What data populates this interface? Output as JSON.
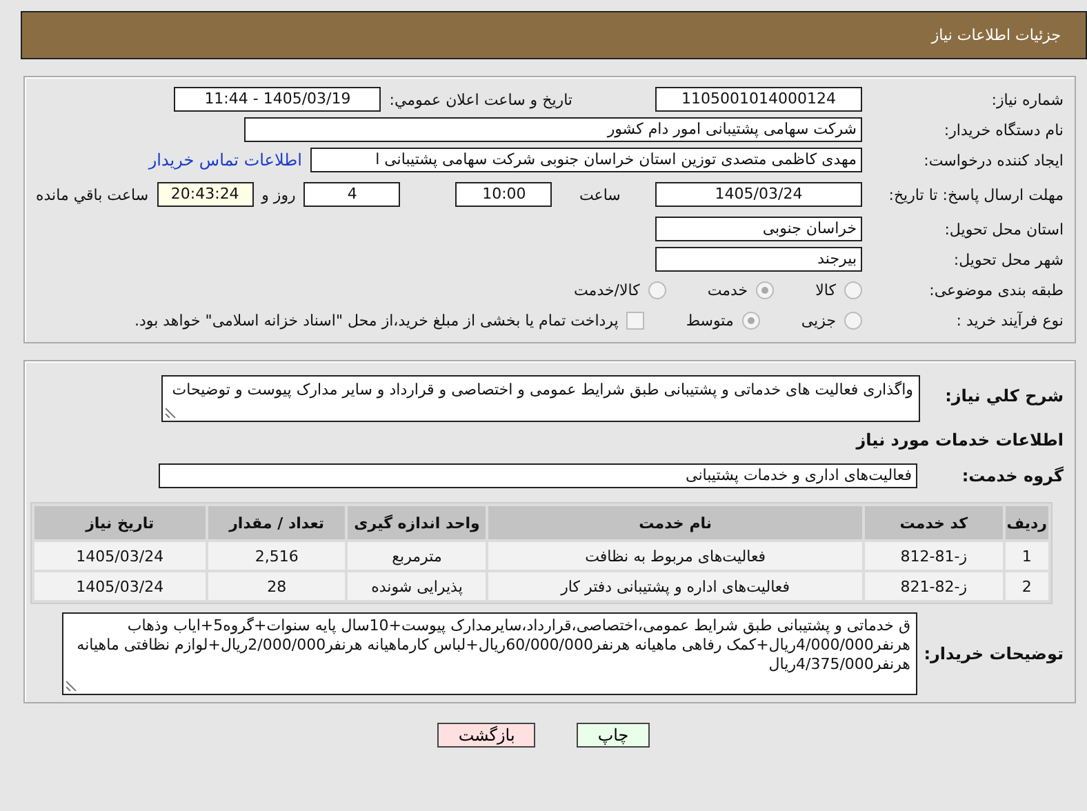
{
  "header": {
    "title": "جزئیات اطلاعات نیاز"
  },
  "details": {
    "need_number": {
      "label": "شماره نیاز:",
      "value": "1105001014000124"
    },
    "announce": {
      "label": "تاریخ و ساعت اعلان عمومي:",
      "value": "1405/03/19 - 11:44"
    },
    "buyer": {
      "label": "نام دستگاه خریدار:",
      "value": "شرکت سهامی پشتیبانی امور دام کشور"
    },
    "creator": {
      "label": "ایجاد کننده درخواست:",
      "value": "مهدی کاظمی متصدی توزین استان خراسان جنوبی شرکت سهامی پشتیبانی ا",
      "link": "اطلاعات تماس خریدار"
    },
    "deadline": {
      "label": "مهلت ارسال پاسخ: تا تاریخ:",
      "date": "1405/03/24",
      "time_label": "ساعت",
      "time": "10:00",
      "days": "4",
      "days_label": "روز و",
      "remaining": "20:43:24",
      "remaining_label": "ساعت باقي مانده"
    },
    "province": {
      "label": "استان محل تحویل:",
      "value": "خراسان جنوبی"
    },
    "city": {
      "label": "شهر محل تحویل:",
      "value": "بیرجند"
    },
    "category": {
      "label": "طبقه بندی موضوعی:",
      "options": [
        {
          "label": "کالا",
          "selected": false
        },
        {
          "label": "خدمت",
          "selected": true
        },
        {
          "label": "کالا/خدمت",
          "selected": false
        }
      ]
    },
    "process": {
      "label": "نوع فرآیند خرید :",
      "options": [
        {
          "label": "جزیی",
          "selected": false
        },
        {
          "label": "متوسط",
          "selected": true
        }
      ],
      "treasury": {
        "label": "پرداخت تمام یا بخشی از مبلغ خرید،از محل \"اسناد خزانه اسلامی\" خواهد بود.",
        "checked": false
      }
    }
  },
  "services": {
    "summary": {
      "label": "شرح کلي نیاز:",
      "value": "واگذاری فعالیت های خدماتی و پشتیبانی طبق شرایط عمومی و اختصاصی و قرارداد و سایر مدارک پیوست و توضیحات"
    },
    "heading": "اطلاعات خدمات مورد نیاز",
    "group": {
      "label": "گروه خدمت:",
      "value": "فعالیت‌های اداری و خدمات پشتیبانی"
    },
    "table": {
      "columns": [
        "ردیف",
        "کد خدمت",
        "نام خدمت",
        "واحد اندازه گیری",
        "تعداد / مقدار",
        "تاریخ نیاز"
      ],
      "rows": [
        [
          "1",
          "ز-81-812",
          "فعالیت‌های مربوط به نظافت",
          "مترمربع",
          "2,516",
          "1405/03/24"
        ],
        [
          "2",
          "ز-82-821",
          "فعالیت‌های اداره و پشتیبانی دفتر کار",
          "پذیرایی شونده",
          "28",
          "1405/03/24"
        ]
      ]
    },
    "buyer_notes": {
      "label": "توضیحات خریدار:",
      "value": "ق خدماتی و پشتیبانی طبق شرایط عمومی،اختصاصی،قرارداد،سایرمدارک پیوست+10سال پایه سنوات+گروه5+ایاب وذهاب هرنفر4/000/000ریال+کمک رفاهی ماهیانه هرنفر60/000/000ریال+لباس کارماهیانه هرنفر2/000/000ریال+لوازم نظافتی ماهیانه هرنفر4/375/000ریال"
    }
  },
  "buttons": [
    {
      "label": "چاپ",
      "kind": "print"
    },
    {
      "label": "بازگشت",
      "kind": "back"
    }
  ]
}
